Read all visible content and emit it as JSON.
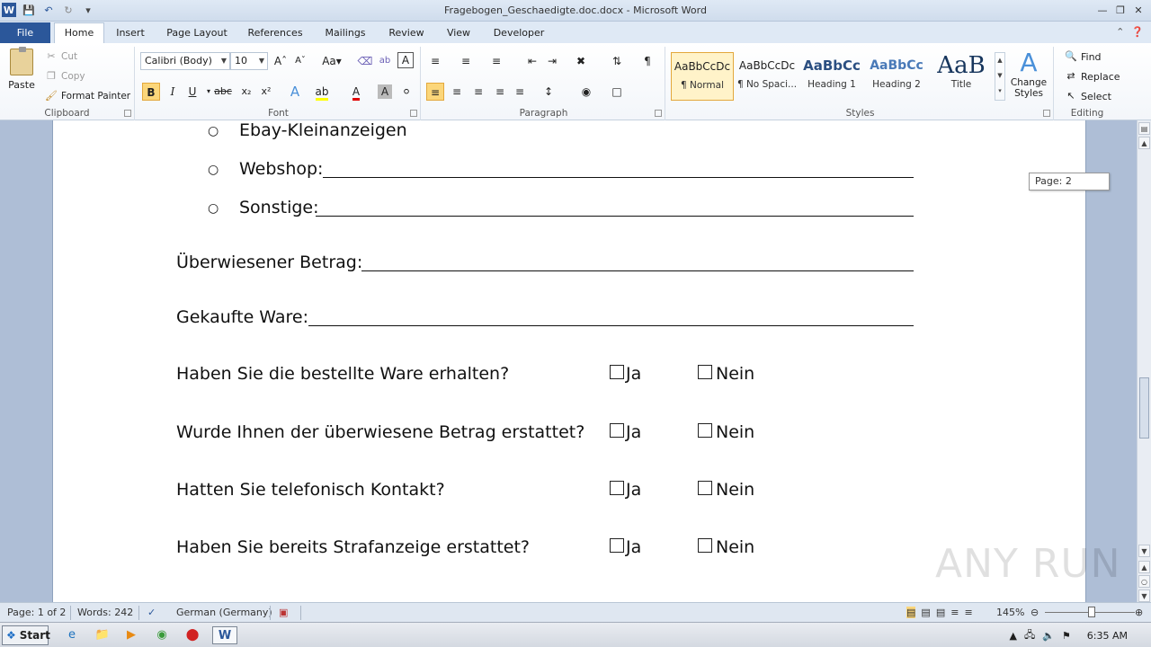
{
  "window": {
    "title": "Fragebogen_Geschaedigte.doc.docx - Microsoft Word",
    "app_icon": "W"
  },
  "tabs": [
    {
      "label": "File"
    },
    {
      "label": "Home"
    },
    {
      "label": "Insert"
    },
    {
      "label": "Page Layout"
    },
    {
      "label": "References"
    },
    {
      "label": "Mailings"
    },
    {
      "label": "Review"
    },
    {
      "label": "View"
    },
    {
      "label": "Developer"
    }
  ],
  "ribbon": {
    "clipboard": {
      "paste": "Paste",
      "cut": "Cut",
      "copy": "Copy",
      "format_painter": "Format Painter",
      "label": "Clipboard"
    },
    "font": {
      "name": "Calibri (Body)",
      "size": "10",
      "label": "Font"
    },
    "paragraph": {
      "label": "Paragraph"
    },
    "styles": {
      "items": [
        {
          "preview": "AaBbCcDc",
          "name": "¶ Normal"
        },
        {
          "preview": "AaBbCcDc",
          "name": "¶ No Spaci..."
        },
        {
          "preview": "AaBbCc",
          "name": "Heading 1"
        },
        {
          "preview": "AaBbCc",
          "name": "Heading 2"
        },
        {
          "preview": "AaB",
          "name": "Title"
        }
      ],
      "change_styles": "Change Styles",
      "label": "Styles"
    },
    "editing": {
      "find": "Find",
      "replace": "Replace",
      "select": "Select",
      "label": "Editing"
    }
  },
  "document": {
    "bullets": [
      {
        "text": "Ebay-Kleinanzeigen"
      },
      {
        "text": "Webshop:"
      },
      {
        "text": "Sonstige:"
      }
    ],
    "fields": [
      {
        "text": "Überwiesener  Betrag:"
      },
      {
        "text": "Gekaufte Ware:"
      }
    ],
    "questions": [
      {
        "text": "Haben Sie die bestellte Ware erhalten?",
        "yes": "Ja",
        "no": "Nein"
      },
      {
        "text": "Wurde Ihnen der überwiesene Betrag erstattet?",
        "yes": "Ja",
        "no": "Nein"
      },
      {
        "text": "Hatten Sie telefonisch Kontakt?",
        "yes": "Ja",
        "no": "Nein"
      },
      {
        "text": "Haben Sie bereits Strafanzeige erstattet?",
        "yes": "Ja",
        "no": "Nein"
      }
    ],
    "page_tip": "Page: 2"
  },
  "statusbar": {
    "page": "Page: 1 of 2",
    "words": "Words: 242",
    "language": "German (Germany)",
    "zoom": "145%"
  },
  "taskbar": {
    "start": "Start",
    "clock": "6:35 AM"
  },
  "watermark": "ANY RUN"
}
